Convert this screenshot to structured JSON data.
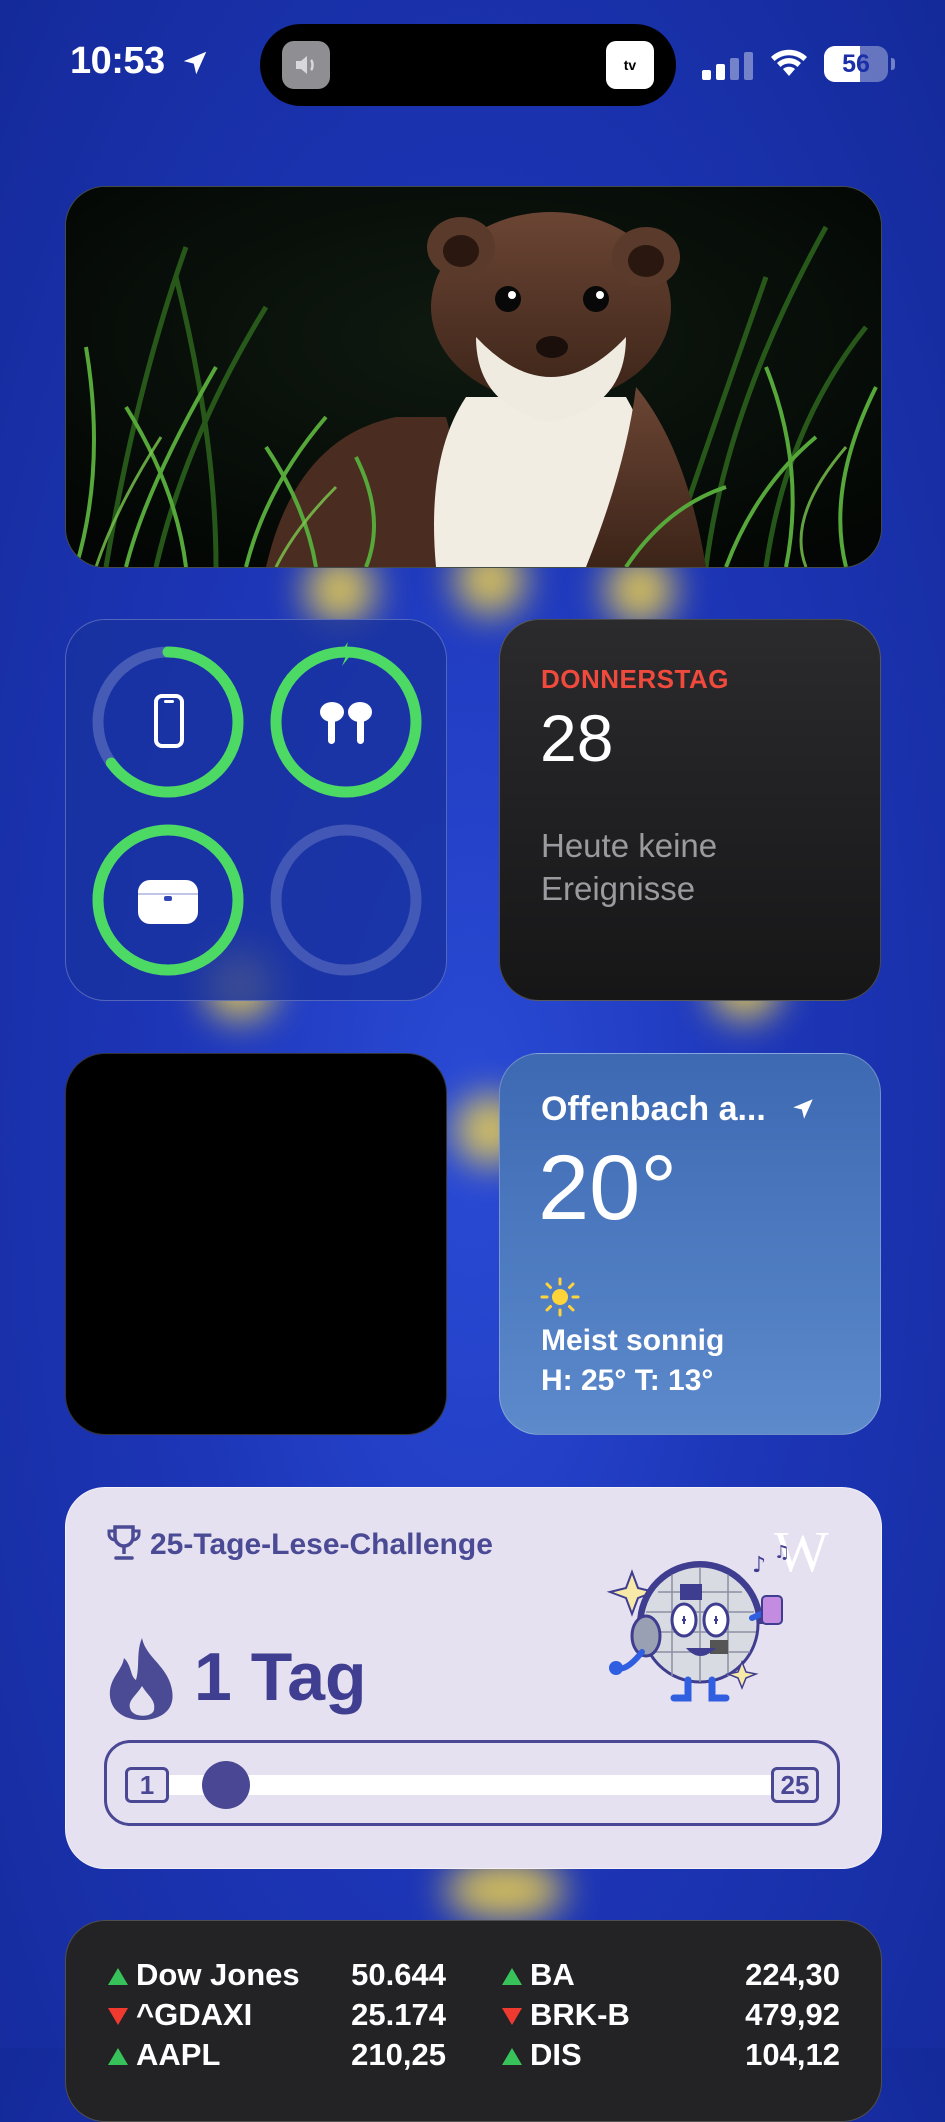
{
  "status_bar": {
    "time": "10:53",
    "battery_level": "56",
    "battery_percent": 56,
    "island_app_label": "tv"
  },
  "battery_widget": {
    "devices": [
      {
        "name": "iPhone",
        "icon": "iphone-icon",
        "level": 0.65
      },
      {
        "name": "AirPods",
        "icon": "airpods-icon",
        "level": 1.0,
        "charging": true
      },
      {
        "name": "AirPods Case",
        "icon": "airpods-case-icon",
        "level": 1.0
      },
      {
        "name": "",
        "icon": "",
        "level": 0
      }
    ],
    "ring_color": "#4cd964"
  },
  "calendar": {
    "weekday": "DONNERSTAG",
    "date": "28",
    "no_events": "Heute keine Ereignisse"
  },
  "weather": {
    "city": "Offenbach a...",
    "temperature": "20°",
    "condition": "Meist sonnig",
    "high_low": "H: 25° T: 13°"
  },
  "wiki": {
    "challenge_title": "25-Tage-Lese-Challenge",
    "streak": "1 Tag",
    "start": "1",
    "end": "25",
    "logo": "W",
    "progress": 0.04
  },
  "stocks": {
    "rows": [
      {
        "left": {
          "symbol": "Dow Jones",
          "value": "50.644",
          "direction": "up"
        },
        "right": {
          "symbol": "BA",
          "value": "224,30",
          "direction": "up"
        }
      },
      {
        "left": {
          "symbol": "^GDAXI",
          "value": "25.174",
          "direction": "down"
        },
        "right": {
          "symbol": "BRK-B",
          "value": "479,92",
          "direction": "down"
        }
      },
      {
        "left": {
          "symbol": "AAPL",
          "value": "210,25",
          "direction": "up"
        },
        "right": {
          "symbol": "DIS",
          "value": "104,12",
          "direction": "up"
        }
      }
    ]
  }
}
